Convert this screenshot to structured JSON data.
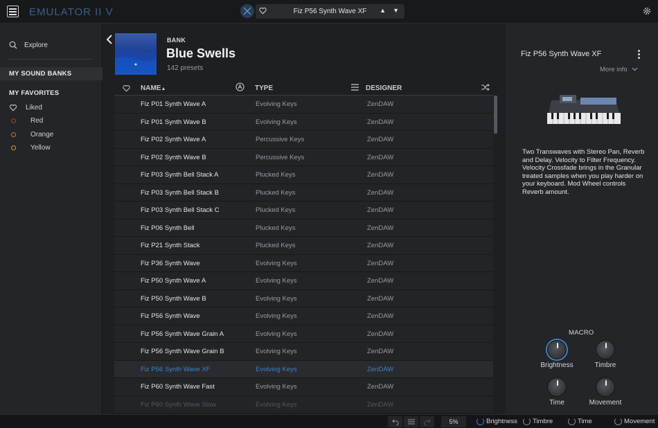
{
  "app": {
    "title": "EMULATOR II V"
  },
  "topbar": {
    "preset_name": "Fiz P56 Synth Wave XF",
    "prev_glyph": "▲",
    "next_glyph": "▼"
  },
  "sidebar": {
    "explore_label": "Explore",
    "my_sound_banks": "MY SOUND BANKS",
    "my_favorites": "MY FAVORITES",
    "favorites": [
      {
        "label": "Liked",
        "icon": "heart-icon"
      },
      {
        "label": "Red",
        "color": "#c0392b"
      },
      {
        "label": "Orange",
        "color": "#d2772b"
      },
      {
        "label": "Yellow",
        "color": "#c9a227"
      }
    ]
  },
  "bank": {
    "label": "BANK",
    "name": "Blue Swells",
    "count": "142 presets"
  },
  "table": {
    "headers": {
      "name": "NAME",
      "type": "TYPE",
      "designer": "DESIGNER"
    },
    "rows": [
      {
        "name": "Fiz P01 Synth Wave A",
        "type": "Evolving Keys",
        "designer": "ZenDAW"
      },
      {
        "name": "Fiz P01 Synth Wave B",
        "type": "Evolving Keys",
        "designer": "ZenDAW"
      },
      {
        "name": "Fiz P02 Synth Wave A",
        "type": "Percussive Keys",
        "designer": "ZenDAW"
      },
      {
        "name": "Fiz P02 Synth Wave B",
        "type": "Percussive Keys",
        "designer": "ZenDAW"
      },
      {
        "name": "Fiz P03 Synth Bell Stack A",
        "type": "Plucked Keys",
        "designer": "ZenDAW"
      },
      {
        "name": "Fiz P03 Synth Bell Stack B",
        "type": "Plucked Keys",
        "designer": "ZenDAW"
      },
      {
        "name": "Fiz P03 Synth Bell Stack C",
        "type": "Plucked Keys",
        "designer": "ZenDAW"
      },
      {
        "name": "Fiz P06 Synth Bell",
        "type": "Plucked Keys",
        "designer": "ZenDAW"
      },
      {
        "name": "Fiz P21 Synth Stack",
        "type": "Plucked Keys",
        "designer": "ZenDAW"
      },
      {
        "name": "Fiz P36 Synth Wave",
        "type": "Evolving Keys",
        "designer": "ZenDAW"
      },
      {
        "name": "Fiz P50 Synth Wave A",
        "type": "Evolving Keys",
        "designer": "ZenDAW"
      },
      {
        "name": "Fiz P50 Synth Wave B",
        "type": "Evolving Keys",
        "designer": "ZenDAW"
      },
      {
        "name": "Fiz P56 Synth Wave",
        "type": "Evolving Keys",
        "designer": "ZenDAW"
      },
      {
        "name": "Fiz P56 Synth Wave Grain A",
        "type": "Evolving Keys",
        "designer": "ZenDAW"
      },
      {
        "name": "Fiz P56 Synth Wave Grain B",
        "type": "Evolving Keys",
        "designer": "ZenDAW"
      },
      {
        "name": "Fiz P56 Synth Wave XF",
        "type": "Evolving Keys",
        "designer": "ZenDAW",
        "selected": true
      },
      {
        "name": "Fiz P60 Synth Wave Fast",
        "type": "Evolving Keys",
        "designer": "ZenDAW"
      },
      {
        "name": "Fiz P60 Synth Wave Slow",
        "type": "Evolving Keys",
        "designer": "ZenDAW",
        "faded": true
      }
    ]
  },
  "details": {
    "preset_name": "Fiz P56 Synth Wave XF",
    "more_info": "More info",
    "description": "Two Transwaves with Stereo Pan, Reverb and Delay. Velocity to Filter Frequency. Velocity Crossfade brings in the Granular treated samples when you play harder on your keyboard. Mod Wheel controls Reverb amount.",
    "macro_title": "MACRO",
    "macros": [
      "Brightness",
      "Timbre",
      "Time",
      "Movement"
    ]
  },
  "bottombar": {
    "zoom": "5%",
    "macros": [
      "Brightness",
      "Timbre",
      "Time",
      "Movement"
    ]
  },
  "colors": {
    "accent": "#3c82c8",
    "background": "#1e1f22",
    "panel": "#242528"
  }
}
